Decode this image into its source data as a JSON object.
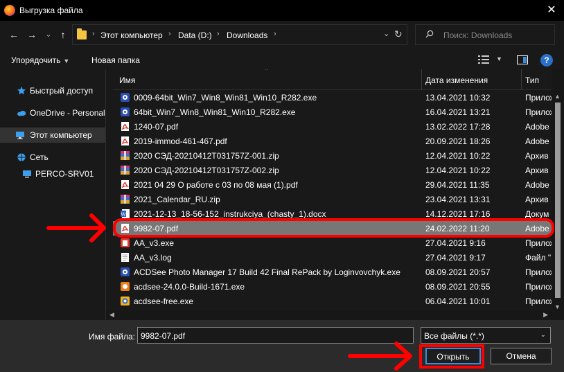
{
  "window": {
    "title": "Выгрузка файла",
    "close_glyph": "✕"
  },
  "nav": {
    "back_glyph": "←",
    "forward_glyph": "→",
    "recent_glyph": "⌄",
    "up_glyph": "↑",
    "breadcrumbs": [
      "Этот компьютер",
      "Data (D:)",
      "Downloads"
    ],
    "refresh_glyph": "↻",
    "search_placeholder": "Поиск: Downloads"
  },
  "toolbar": {
    "organize_label": "Упорядочить",
    "new_folder_label": "Новая папка",
    "help_glyph": "?"
  },
  "sidebar": {
    "items": [
      {
        "label": "Быстрый доступ",
        "icon": "star-icon"
      },
      {
        "label": "OneDrive - Personal",
        "icon": "cloud-icon"
      },
      {
        "label": "Этот компьютер",
        "icon": "computer-icon"
      },
      {
        "label": "Сеть",
        "icon": "network-icon"
      },
      {
        "label": "PERCO-SRV01",
        "icon": "monitor-icon"
      }
    ]
  },
  "columns": {
    "name": "Имя",
    "date": "Дата изменения",
    "type": "Тип"
  },
  "files": [
    {
      "name": "0009-64bit_Win7_Win8_Win81_Win10_R282.exe",
      "date": "13.04.2021 10:32",
      "type": "Прилож",
      "icon": "installer-icon"
    },
    {
      "name": "64bit_Win7_Win8_Win81_Win10_R282.exe",
      "date": "16.04.2021 13:21",
      "type": "Прилож",
      "icon": "installer-icon"
    },
    {
      "name": "1240-07.pdf",
      "date": "13.02.2022 17:28",
      "type": "Adobe",
      "icon": "pdf-icon"
    },
    {
      "name": "2019-immod-461-467.pdf",
      "date": "20.09.2021 18:26",
      "type": "Adobe",
      "icon": "pdf-icon"
    },
    {
      "name": "2020 СЭД-20210412T031757Z-001.zip",
      "date": "12.04.2021 10:22",
      "type": "Архив",
      "icon": "archive-icon"
    },
    {
      "name": "2020 СЭД-20210412T031757Z-002.zip",
      "date": "12.04.2021 10:22",
      "type": "Архив",
      "icon": "archive-icon"
    },
    {
      "name": "2021 04 29 О работе с 03 по 08 мая (1).pdf",
      "date": "29.04.2021 11:35",
      "type": "Adobe",
      "icon": "pdf-icon"
    },
    {
      "name": "2021_Calendar_RU.zip",
      "date": "23.04.2021 13:31",
      "type": "Архив",
      "icon": "archive-icon"
    },
    {
      "name": "2021-12-13_18-56-152_instrukciya_(chasty_1).docx",
      "date": "14.12.2021 17:16",
      "type": "Докум",
      "icon": "word-icon"
    },
    {
      "name": "9982-07.pdf",
      "date": "24.02.2022 11:20",
      "type": "Adobe",
      "icon": "pdf-icon",
      "selected": true
    },
    {
      "name": "AA_v3.exe",
      "date": "27.04.2021 9:16",
      "type": "Прилож",
      "icon": "app-icon"
    },
    {
      "name": "AA_v3.log",
      "date": "27.04.2021 9:17",
      "type": "Файл \"",
      "icon": "text-file-icon"
    },
    {
      "name": "ACDSee Photo Manager 17 Build 42 Final RePack by Loginvovchyk.exe",
      "date": "08.09.2021 20:57",
      "type": "Прилож",
      "icon": "installer-icon"
    },
    {
      "name": "acdsee-24.0.0-Build-1671.exe",
      "date": "08.09.2021 20:55",
      "type": "Прилож",
      "icon": "acdsee-icon"
    },
    {
      "name": "acdsee-free.exe",
      "date": "06.04.2021 10:01",
      "type": "Прилож",
      "icon": "acdsee-free-icon"
    }
  ],
  "bottom": {
    "filename_label": "Имя файла:",
    "filename_value": "9982-07.pdf",
    "filter_value": "Все файлы (*.*)",
    "open_label": "Открыть",
    "cancel_label": "Отмена"
  },
  "colors": {
    "accent": "#3f8cd8",
    "annotation": "#ff0000",
    "selected_row": "#777777"
  }
}
